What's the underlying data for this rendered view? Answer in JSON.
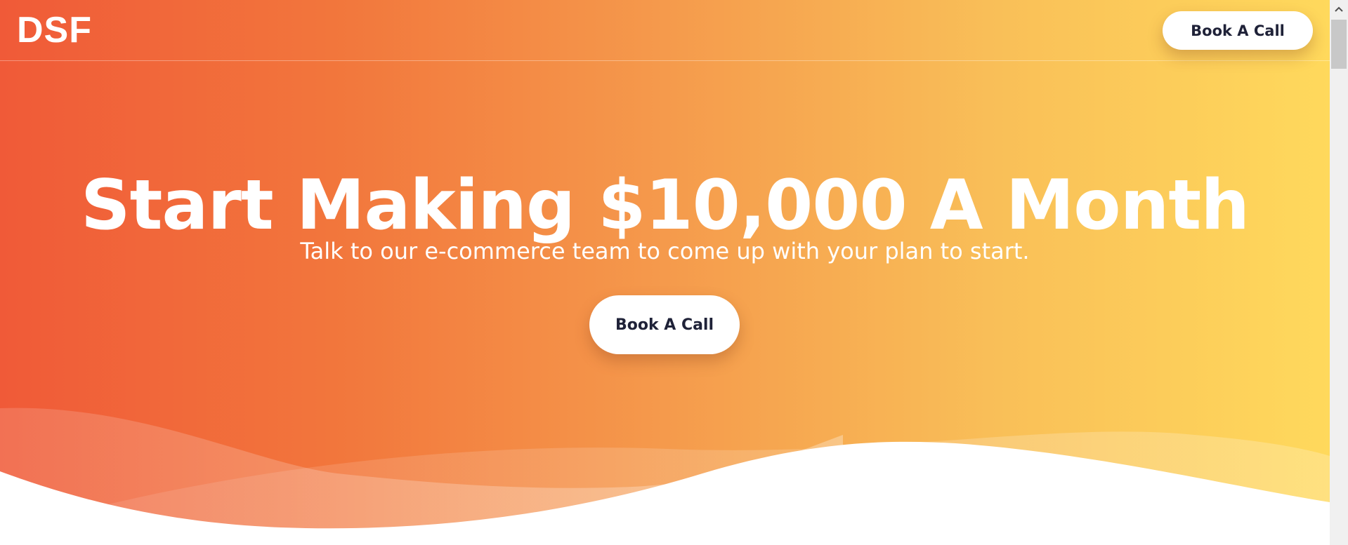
{
  "navbar": {
    "logo": "DSF",
    "cta_label": "Book A Call"
  },
  "hero": {
    "headline": "Start Making $10,000 A Month",
    "subheadline": "Talk to our e-commerce team to come up with your plan to start.",
    "cta_label": "Book A Call"
  },
  "colors": {
    "gradient_start": "#f05a38",
    "gradient_end": "#ffd95c",
    "button_bg": "#ffffff",
    "button_text": "#1f2238"
  },
  "icons": {
    "scroll_up": "chevron-up-icon"
  }
}
